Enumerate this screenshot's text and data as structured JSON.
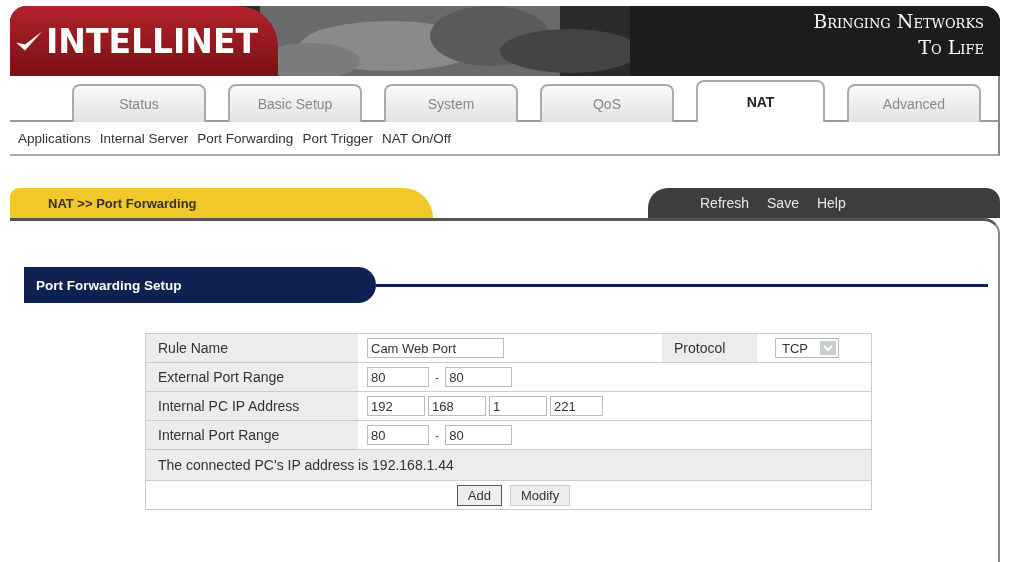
{
  "header": {
    "logo": "INTELLINET",
    "slogan_lines": [
      "Bringing Networks",
      "To Life"
    ]
  },
  "tabs": [
    {
      "label": "Status",
      "selected": false
    },
    {
      "label": "Basic Setup",
      "selected": false
    },
    {
      "label": "System",
      "selected": false
    },
    {
      "label": "QoS",
      "selected": false
    },
    {
      "label": "NAT",
      "selected": true
    },
    {
      "label": "Advanced",
      "selected": false
    }
  ],
  "subnav": [
    "Applications",
    "Internal Server",
    "Port Forwarding",
    "Port Trigger",
    "NAT On/Off"
  ],
  "breadcrumb": "NAT >> Port Forwarding",
  "toolbar": [
    "Refresh",
    "Save",
    "Help"
  ],
  "section_title": "Port Forwarding Setup",
  "form": {
    "rows": [
      {
        "kind": "text",
        "label": "Rule Name",
        "value": "Cam Web Port",
        "extra_label": "Protocol",
        "select": "TCP"
      },
      {
        "kind": "range",
        "label": "External Port Range",
        "from": "80",
        "separator": "-",
        "to": "80"
      },
      {
        "kind": "ip",
        "label": "Internal PC IP Address",
        "octets": [
          "192",
          "168",
          "1",
          "221"
        ]
      },
      {
        "kind": "range",
        "label": "Internal Port Range",
        "from": "80",
        "separator": "-",
        "to": "80"
      }
    ],
    "info": "The connected PC's IP address is 192.168.1.44",
    "buttons": [
      {
        "label": "Add",
        "focused": true
      },
      {
        "label": "Modify",
        "focused": false
      }
    ]
  }
}
